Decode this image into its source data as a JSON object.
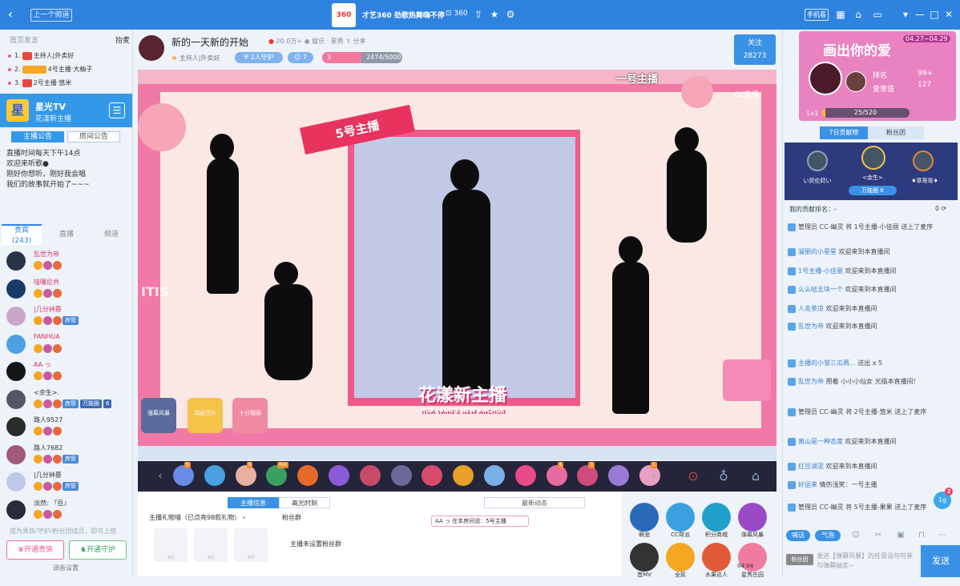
{
  "titlebar": {
    "back": "‹",
    "prev": "上一个频道",
    "logo": "360",
    "title": "才艺360 劲歌热舞嗨不停",
    "count": "360",
    "mobile": "手机看",
    "win_min": "—",
    "win_max": "□",
    "win_close": "✕"
  },
  "left": {
    "rank_header": "首页发言",
    "rank_switch": "抬麦",
    "ranks": [
      {
        "no": "1.",
        "text": "主持人|外卖好"
      },
      {
        "no": "2.",
        "text": "4号主播·大柚子"
      },
      {
        "no": "3.",
        "text": "2号主播·悠米"
      }
    ],
    "channel_icon": "星",
    "channel_name": "星光TV",
    "channel_sub": "花漾新主播",
    "menu_icon": "☰",
    "tabs": [
      "主播公告",
      "房间公告"
    ],
    "notice": [
      "直播时间每天下午14点",
      "欢迎来听歌●",
      "刚好你想听，刚好我会唱",
      "我们的故事就开始了~~~"
    ],
    "viewer_tabs": [
      "贵宾",
      "直播",
      "频道"
    ],
    "viewer_count": "(243)",
    "viewers": [
      {
        "name": "乱世为帝",
        "badges": []
      },
      {
        "name": "哇噻尼共",
        "badges": []
      },
      {
        "name": "|几分钟慕",
        "badges": [
          "房管"
        ]
      },
      {
        "name": "FANHUA",
        "badges": []
      },
      {
        "name": "AA っ",
        "badges": []
      },
      {
        "name": "<余生>.",
        "badges": [
          "房管",
          "万能圈",
          "6"
        ]
      },
      {
        "name": "路人9527",
        "badges": []
      },
      {
        "name": "路人7682",
        "badges": [
          "房管"
        ]
      },
      {
        "name": "|几分钟慕",
        "badges": [
          "房管"
        ]
      },
      {
        "name": "淡然: 『豆』",
        "badges": []
      }
    ],
    "footer_hint": "成为贵族/守护/粉丝团成员，即可上座",
    "btn_noble": "开通贵族",
    "btn_guard": "开通守护",
    "footer_set": "调音设置"
  },
  "header": {
    "title": "新的一天新的开始",
    "heat": "20.0万+",
    "category": "娱乐 · 星秀",
    "share": "分享",
    "host": "主持人|外卖好",
    "guards": "2人守护",
    "fans": "7",
    "level": "3",
    "progress_text": "2474/5000",
    "progress": 0.4948,
    "follow": "关注",
    "follow_count": "28273"
  },
  "video": {
    "corner_label": "一号主播",
    "cc_logo": "CC直播",
    "host_label": "5号主播",
    "banner": "花漾新主播",
    "banner_sub": "HUA YANG'S NEW ANCHOR",
    "side_text": "ITIS",
    "mini_boxes": [
      "强幕风暴",
      "鸿运当头",
      "十分靓丽"
    ]
  },
  "gifts": [
    {
      "hot": "5"
    },
    {
      "hot": ""
    },
    {
      "hot": "5"
    },
    {
      "hot": "hot"
    },
    {
      "hot": ""
    },
    {
      "hot": ""
    },
    {
      "hot": ""
    },
    {
      "hot": ""
    },
    {
      "hot": ""
    },
    {
      "hot": ""
    },
    {
      "hot": ""
    },
    {
      "hot": ""
    },
    {
      "hot": "1"
    },
    {
      "hot": "1"
    },
    {
      "hot": ""
    },
    {
      "hot": "1"
    }
  ],
  "gift_prev": "‹",
  "gift_next": "›",
  "info": {
    "tabs": [
      "主播信息",
      "高光时刻"
    ],
    "newest": "最新动态",
    "gift_wall": "主播礼物墙（已点亮98款礼物）",
    "fans_group": "粉丝群",
    "no_fans_group": "主播未设置粉丝群",
    "chat_user": "AA っ",
    "chat_text": "在本房间说：5号主播",
    "slot_counts": [
      "x0",
      "x0",
      "x0"
    ]
  },
  "actions": [
    {
      "label": "萌宠",
      "color": "#2a6ab8"
    },
    {
      "label": "CC帮派",
      "color": "#3aa0e0"
    },
    {
      "label": "积分商城",
      "color": "#1fa0c8"
    },
    {
      "label": "弹幕风暴",
      "color": "#9a4ac8"
    },
    {
      "label": "首MV",
      "color": "#333333"
    },
    {
      "label": "全民",
      "color": "#f5a623"
    },
    {
      "label": "水果达人",
      "color": "#e05a3a"
    },
    {
      "label": "星秀庄园",
      "color": "#f07aa0"
    }
  ],
  "action_timer": "04:04",
  "right": {
    "promo_title": "画出你的爱",
    "promo_date": "04.27~04.29",
    "rank_label": "排名",
    "rank_value": "99+",
    "love_label": "爱意值",
    "love_value": "127",
    "level": "Lv1",
    "progress_text": "25/520",
    "progress": 0.048,
    "tabs": [
      "7日贡献榜",
      "粉丝团"
    ],
    "podium": [
      {
        "name": "い荧伦莳い",
        "color": "#8ea0b8"
      },
      {
        "name": "<余生>.",
        "color": "#f5c24a"
      },
      {
        "name": "♦章哥哥♦",
        "color": "#e0863a"
      }
    ],
    "podium_badge": "万能圈 6",
    "contrib_label": "我的贡献排名：-",
    "contrib_value": "0",
    "messages": [
      {
        "text": "管理员 CC-幽灵 将 1号主播-小佳丽 送上了麦序",
        "user": ""
      },
      {
        "text": "欢迎来到本直播间",
        "user": "凝丽的小星星"
      },
      {
        "text": "欢迎来到本直播间",
        "user": "1号主播-小佳丽"
      },
      {
        "text": "欢迎来到本直播间",
        "user": "么么哒五块一个"
      },
      {
        "text": "欢迎来到本直播间",
        "user": "人走茶凉"
      },
      {
        "text": "欢迎来到本直播间",
        "user": "乱世为帝"
      },
      {
        "text": "送出 x 5",
        "user": "主播的小邹三瓜两..."
      },
      {
        "text": "用着 小小小仙女 光临本直播间!",
        "user": "乱世为帝"
      },
      {
        "text": "管理员 CC-幽灵 将 2号主播-悠米 送上了麦序",
        "user": ""
      },
      {
        "text": "欢迎来到本直播间",
        "user": "离山是一种态度"
      },
      {
        "text": "欢迎来到本直播间",
        "user": "红豆湖泥"
      },
      {
        "text": "情伤浅笑：一号主播",
        "user": "好运来"
      },
      {
        "text": "管理员 CC-幽灵 将 5号主播-果果 送上了麦序",
        "user": ""
      }
    ],
    "input_tabs": [
      "喊话",
      "气泡"
    ],
    "fan_label": "粉丝团",
    "input_placeholder": "发送【弹幕风暴】的任意语句可参与弹幕抽奖~",
    "send": "发送",
    "badge_val": "1g",
    "badge_num": "2"
  }
}
